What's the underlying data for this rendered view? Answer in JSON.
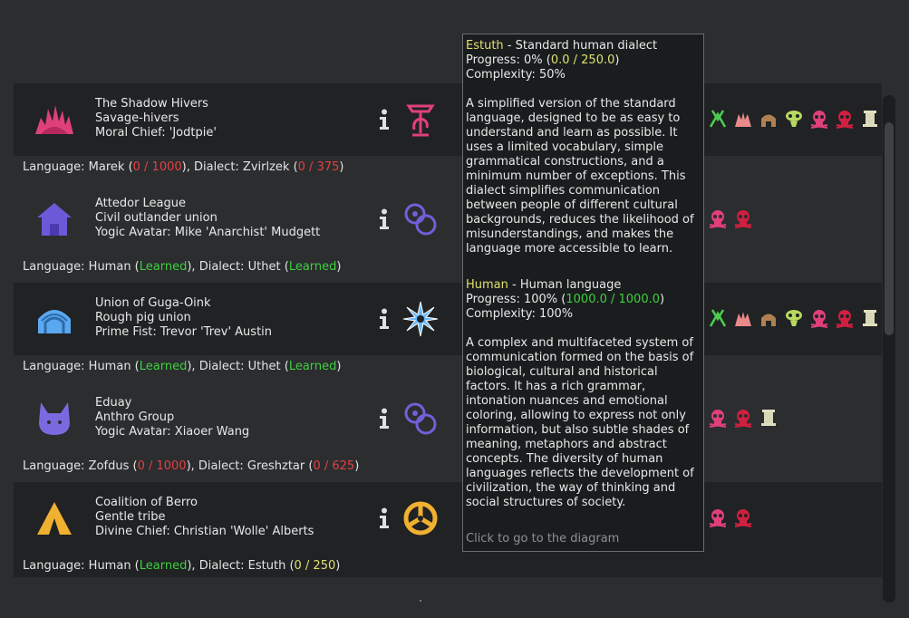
{
  "factions": [
    {
      "name": "The Shadow Hivers",
      "type": "Savage-hivers",
      "leader": "Moral Chief:  'Jodtpie'",
      "icon": "hive-icon",
      "ideology_icon": "fountain-icon",
      "relations": [
        "green-tongs-icon",
        "ruin-icon",
        "hut-icon",
        "alien-skull-icon",
        "pink-skull-icon",
        "red-skull-icon",
        "pillar-icon"
      ]
    },
    {
      "name": "Attedor League",
      "type": "Civil outlander union",
      "leader": "Yogic Avatar: Mike 'Anarchist' Mudgett",
      "icon": "house-icon",
      "ideology_icon": "linked-rings-icon",
      "relations": [
        "pink-skull-icon",
        "red-skull-icon"
      ]
    },
    {
      "name": "Union of Guga-Oink",
      "type": "Rough pig union",
      "leader": "Prime Fist: Trevor 'Trev' Austin",
      "icon": "dome-icon",
      "ideology_icon": "star-burst-icon",
      "relations": [
        "green-tongs-icon",
        "ruin-icon",
        "hut-icon",
        "alien-skull-icon",
        "pink-skull-icon",
        "red-skull-icon",
        "pillar-icon"
      ]
    },
    {
      "name": "Eduay",
      "type": "Anthro Group",
      "leader": "Yogic Avatar: Xiaoer Wang",
      "icon": "fox-head-icon",
      "ideology_icon": "linked-rings-icon",
      "relations": [
        "pink-skull-icon",
        "red-skull-icon",
        "pillar-icon"
      ]
    },
    {
      "name": "Coalition of Berro",
      "type": "Gentle tribe",
      "leader": "Divine Chief: Christian 'Wolle' Alberts",
      "icon": "tent-icon",
      "ideology_icon": "triskelion-icon",
      "relations": [
        "pink-skull-icon",
        "red-skull-icon"
      ]
    }
  ],
  "languages": [
    {
      "p1": "Language: Marek (",
      "v1": "0 / 1000",
      "p2": "), Dialect: Zvirlzek (",
      "v2": "0 / 375",
      "p3": ")"
    },
    {
      "p1": "Language: Human (",
      "v1": "Learned",
      "p2": "), Dialect: Uthet (",
      "v2": "Learned",
      "p3": ")"
    },
    {
      "p1": "Language: Human (",
      "v1": "Learned",
      "p2": "), Dialect: Uthet (",
      "v2": "Learned",
      "p3": ")"
    },
    {
      "p1": "Language: Zofdus (",
      "v1": "0 / 1000",
      "p2": "), Dialect: Greshztar (",
      "v2": "0 / 625",
      "p3": ")"
    },
    {
      "p1": "Language: Human (",
      "v1": "Learned",
      "p2": "), Dialect: Estuth (",
      "v2": "0 / 250",
      "p3": ")"
    }
  ],
  "tooltip": {
    "dialect_name": "Estuth",
    "dialect_desc": " - Standard human dialect",
    "dialect_progress_prefix": "Progress: 0% (",
    "dialect_progress_value": "0.0 / 250.0",
    "dialect_progress_suffix": ")",
    "dialect_complexity": "Complexity: 50%",
    "dialect_text": "A simplified version of the standard language, designed to be as easy to understand and learn as possible. It uses a limited vocabulary, simple grammatical constructions, and a minimum number of exceptions. This dialect simplifies communication between people of different cultural backgrounds, reduces the likelihood of misunderstandings, and makes the language more accessible to learn.",
    "language_name": "Human",
    "language_desc": " - Human language",
    "language_progress_prefix": "Progress: 100% (",
    "language_progress_value": "1000.0 / 1000.0",
    "language_progress_suffix": ")",
    "language_complexity": "Complexity: 100%",
    "language_text": "A complex and multifaceted system of communication formed on the basis of biological, cultural and historical factors. It has a rich grammar, intonation nuances and emotional coloring, allowing to express not only information, but also subtle shades of meaning, metaphors and abstract concepts. The diversity of human languages reflects the development of civilization, the way of thinking and social structures of society.",
    "footer": "Click to go to the diagram"
  },
  "colors": {
    "learned": "#3ed03e",
    "unlearned": "#e54040",
    "in_progress": "#e0e070",
    "hive": "#e0407a",
    "house": "#6a5ad8",
    "dome": "#5aa8f0",
    "fox": "#7a6ae0",
    "tent": "#f0b030"
  }
}
